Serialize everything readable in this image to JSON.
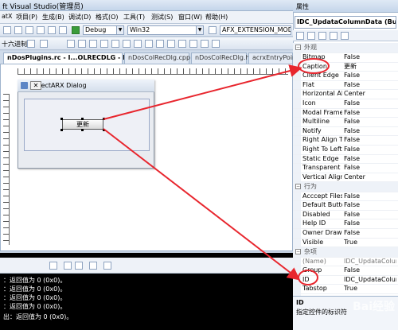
{
  "window": {
    "title": "ft Visual Studio(管理员)"
  },
  "menu": [
    "atX",
    "项目(P)",
    "生成(B)",
    "调试(D)",
    "格式(O)",
    "工具(T)",
    "测试(S)",
    "窗口(W)",
    "帮助(H)"
  ],
  "toolbar": {
    "config_value": "Debug",
    "platform_value": "Win32",
    "define_value": "AFX_EXTENSION_MODU",
    "hex_label": "十六进制"
  },
  "tabs": [
    "nDosPlugins.rc - I...OLRECDLG - Dialog*",
    "nDosColRecDlg.cpp",
    "nDosColRecDlg.h",
    "acrxEntryPoint"
  ],
  "dialog": {
    "title": "ObjectARX Dialog",
    "button_label": "更新"
  },
  "properties": {
    "title": "属性",
    "object": "IDC_UpdataColumnData (Butt",
    "rows": [
      {
        "name": "Bitmap",
        "value": "False"
      },
      {
        "name": "Caption",
        "value": "更新"
      },
      {
        "name": "Client Edge",
        "value": "False"
      },
      {
        "name": "Flat",
        "value": "False"
      },
      {
        "name": "Horizontal Ali",
        "value": "Center"
      },
      {
        "name": "Icon",
        "value": "False"
      },
      {
        "name": "Modal Frame",
        "value": "False"
      },
      {
        "name": "Multiline",
        "value": "False"
      },
      {
        "name": "Notify",
        "value": "False"
      },
      {
        "name": "Right Align Te",
        "value": "False"
      },
      {
        "name": "Right To Left",
        "value": "False"
      },
      {
        "name": "Static Edge",
        "value": "False"
      },
      {
        "name": "Transparent",
        "value": "False"
      },
      {
        "name": "Vertical Alignm",
        "value": "Center"
      }
    ],
    "category_behavior": "行为",
    "category_appearance": "外观",
    "rows2": [
      {
        "name": "Acccept Files",
        "value": "False"
      },
      {
        "name": "Default Button",
        "value": "False"
      },
      {
        "name": "Disabled",
        "value": "False"
      },
      {
        "name": "Help ID",
        "value": "False"
      },
      {
        "name": "Owner Draw",
        "value": "False"
      },
      {
        "name": "Visible",
        "value": "True"
      }
    ],
    "category_misc": "杂项",
    "rows3": [
      {
        "name": "(Name)",
        "value": "IDC_UpdataColumn"
      },
      {
        "name": "Group",
        "value": "False"
      },
      {
        "name": "ID",
        "value": "IDC_UpdataColumn"
      },
      {
        "name": "Tabstop",
        "value": "True"
      }
    ],
    "desc_title": "ID",
    "desc_text": "指定控件的标识符"
  },
  "output": {
    "lines": [
      "：返回值为 0 (0x0)。",
      "：返回值为 0 (0x0)。",
      "：返回值为 0 (0x0)。",
      "：返回值为 0 (0x0)。",
      "出：返回值为 0 (0x0)。"
    ]
  },
  "watermark": "Bai经验",
  "colors": {
    "annotation": "#e8262e",
    "title_gradient": "#c4d5ea"
  }
}
